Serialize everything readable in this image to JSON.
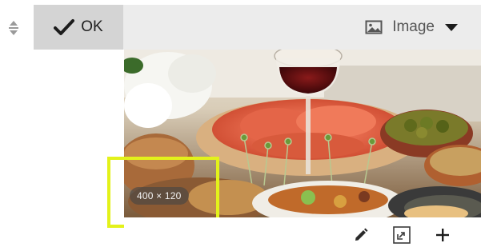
{
  "toolbar": {
    "ok_label": "OK",
    "type_select_label": "Image"
  },
  "image": {
    "size_label": "400 × 120"
  },
  "icons": {
    "drag": "drag-handle-icon",
    "ok": "checkmark-icon",
    "image": "image-icon",
    "dropdown": "caret-down-icon",
    "edit": "pencil-icon",
    "resize": "resize-icon",
    "add": "plus-icon"
  },
  "colors": {
    "highlight": "#e3f21a",
    "toolbar_bg": "#ececec",
    "ok_bg": "#d4d4d4"
  }
}
